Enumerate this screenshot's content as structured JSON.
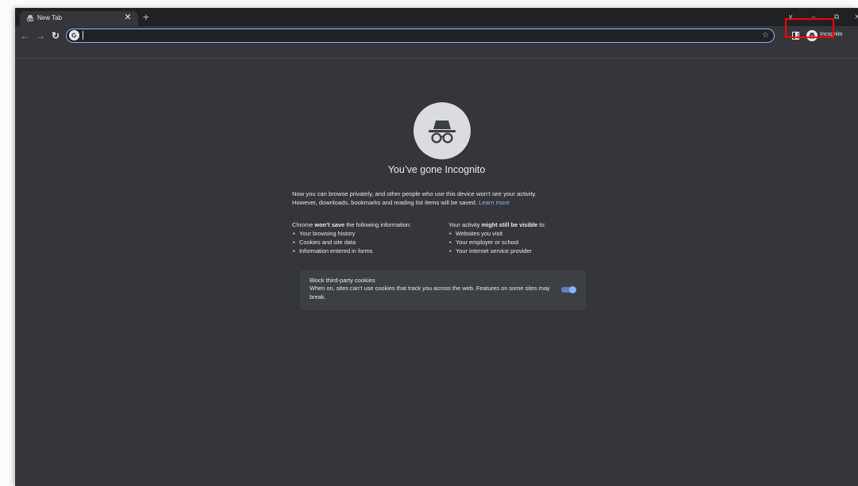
{
  "tab": {
    "title": "New Tab",
    "close_icon": "close-icon",
    "new_tab_symbol": "+"
  },
  "window_controls": {
    "dropdown": "∨",
    "minimize": "–",
    "restore": "⧉",
    "close": "✕"
  },
  "toolbar": {
    "back": "←",
    "forward": "→",
    "reload": "↻",
    "omnibox_value": "",
    "star": "☆",
    "incognito_label": "Incognito"
  },
  "page": {
    "headline": "You’ve gone Incognito",
    "intro_line1": "Now you can browse privately, and other people who use this device won’t see your activity.",
    "intro_line2": "However, downloads, bookmarks and reading list items will be saved.",
    "learn_more": "Learn more",
    "left_head_pre": "Chrome ",
    "left_head_bold": "won’t save",
    "left_head_post": " the following information:",
    "left_items": [
      "Your browsing history",
      "Cookies and site data",
      "Information entered in forms"
    ],
    "right_head_pre": "Your activity ",
    "right_head_bold": "might still be visible",
    "right_head_post": " to:",
    "right_items": [
      "Websites you visit",
      "Your employer or school",
      "Your internet service provider"
    ]
  },
  "cookies": {
    "title": "Block third-party cookies",
    "description": "When on, sites can’t use cookies that track you across the web. Features on some sites may break.",
    "toggle_on": true
  },
  "colors": {
    "frame": "#202124",
    "surface": "#35363a",
    "card": "#3c4043",
    "text": "#e8eaed",
    "link": "#8ab4f8",
    "highlight": "#ff0000"
  }
}
